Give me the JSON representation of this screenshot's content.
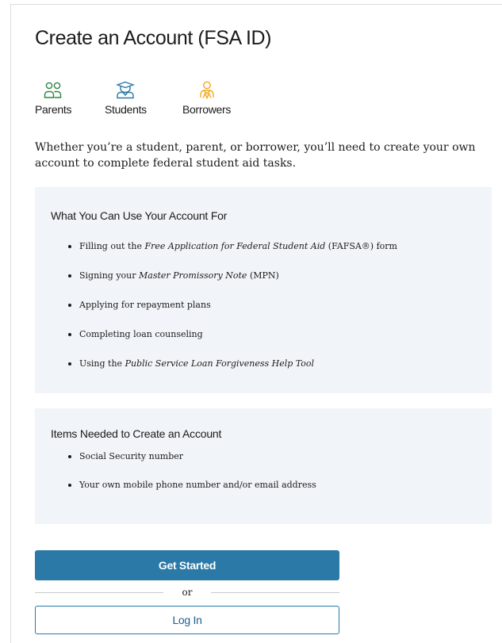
{
  "page": {
    "title": "Create an Account (FSA ID)",
    "roles": [
      {
        "label": "Parents",
        "icon": "parents-icon",
        "color": "#2e8540"
      },
      {
        "label": "Students",
        "icon": "graduate-student-icon",
        "color": "#2a79a6"
      },
      {
        "label": "Borrowers",
        "icon": "borrower-icon",
        "color": "#f2a81d"
      }
    ],
    "intro": "Whether you’re a student, parent, or borrower, you’ll need to create your own account to complete federal student aid tasks."
  },
  "uses_panel": {
    "heading": "What You Can Use Your Account For",
    "items": [
      {
        "before": "Filling out the ",
        "em": "Free Application for Federal Student Aid",
        "after": " (FAFSA®) form"
      },
      {
        "before": "Signing your ",
        "em": "Master Promissory Note",
        "after": " (MPN)"
      },
      {
        "before": "Applying for repayment plans",
        "em": "",
        "after": ""
      },
      {
        "before": "Completing loan counseling",
        "em": "",
        "after": ""
      },
      {
        "before": "Using the ",
        "em": "Public Service Loan Forgiveness Help Tool",
        "after": ""
      }
    ]
  },
  "needed_panel": {
    "heading": "Items Needed to Create an Account",
    "items": [
      "Social Security number",
      "Your own mobile phone number and/or email address"
    ]
  },
  "actions": {
    "primary_label": "Get Started",
    "divider_label": "or",
    "secondary_label": "Log In"
  },
  "colors": {
    "primary": "#2a79a6",
    "panel_background": "#f1f4f8",
    "parents": "#2e8540",
    "students": "#2a79a6",
    "borrowers": "#f2a81d"
  }
}
